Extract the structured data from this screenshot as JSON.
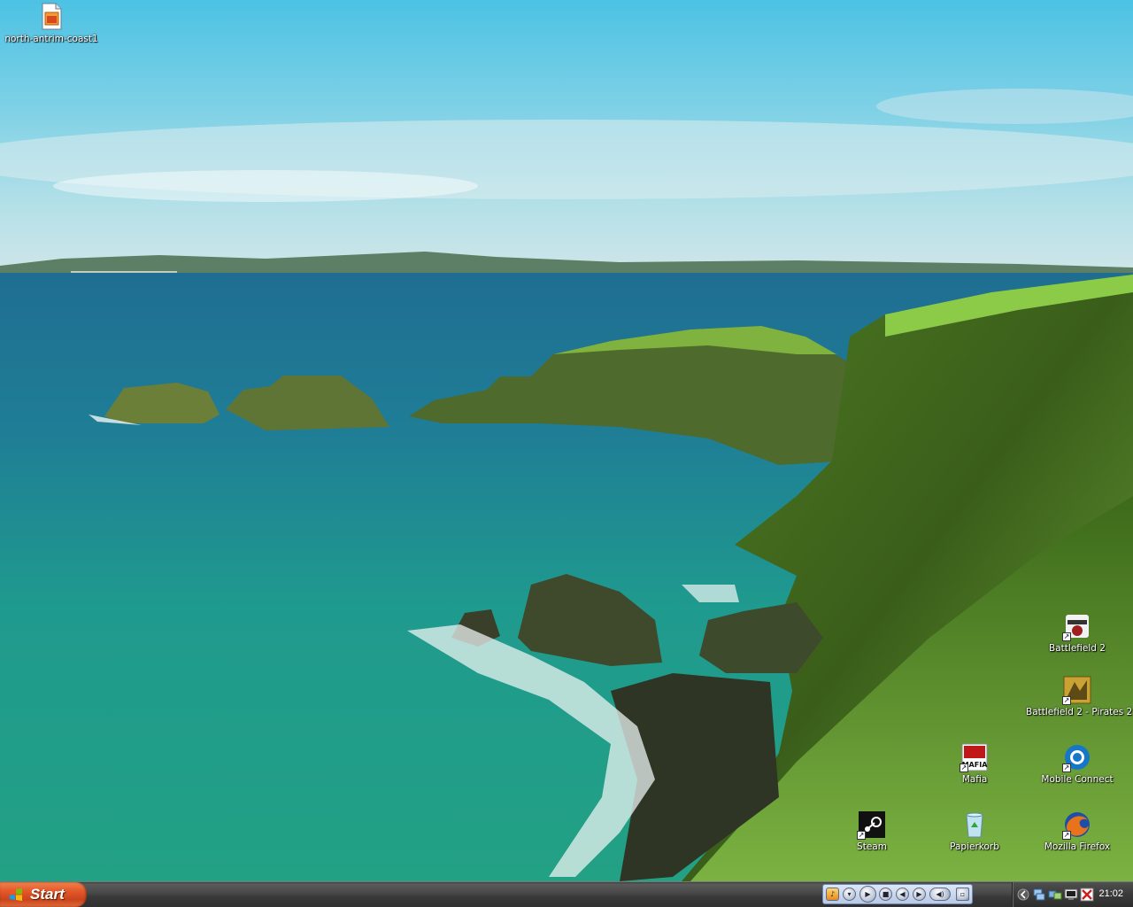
{
  "desktop": {
    "icons": [
      {
        "label": "north-antrim-coast1",
        "icon": "image-file-icon"
      },
      {
        "label": "Battlefield 2",
        "icon": "battlefield2-icon"
      },
      {
        "label": "Battlefield 2 - Pirates 2",
        "icon": "battlefield2-pirates-icon"
      },
      {
        "label": "Mafia",
        "icon": "mafia-icon"
      },
      {
        "label": "Mobile Connect",
        "icon": "mobile-connect-icon"
      },
      {
        "label": "Steam",
        "icon": "steam-icon"
      },
      {
        "label": "Papierkorb",
        "icon": "recycle-bin-icon"
      },
      {
        "label": "Mozilla Firefox",
        "icon": "firefox-icon"
      }
    ]
  },
  "taskbar": {
    "start_label": "Start",
    "clock": "21:02",
    "media_controls": [
      "windows-media-icon",
      "menu-icon",
      "play-icon",
      "stop-icon",
      "previous-icon",
      "next-icon",
      "volume-icon",
      "restore-icon"
    ],
    "tray_icons": [
      "show-hidden-icon",
      "network-icon",
      "network-icon-2",
      "monitor-icon",
      "antivirus-icon"
    ]
  },
  "colors": {
    "sky": "#5ec4e0",
    "sea": "#1a8a86",
    "grass": "#4b8a2a",
    "taskbar": "#3a3a3a",
    "start": "#e4592b"
  }
}
